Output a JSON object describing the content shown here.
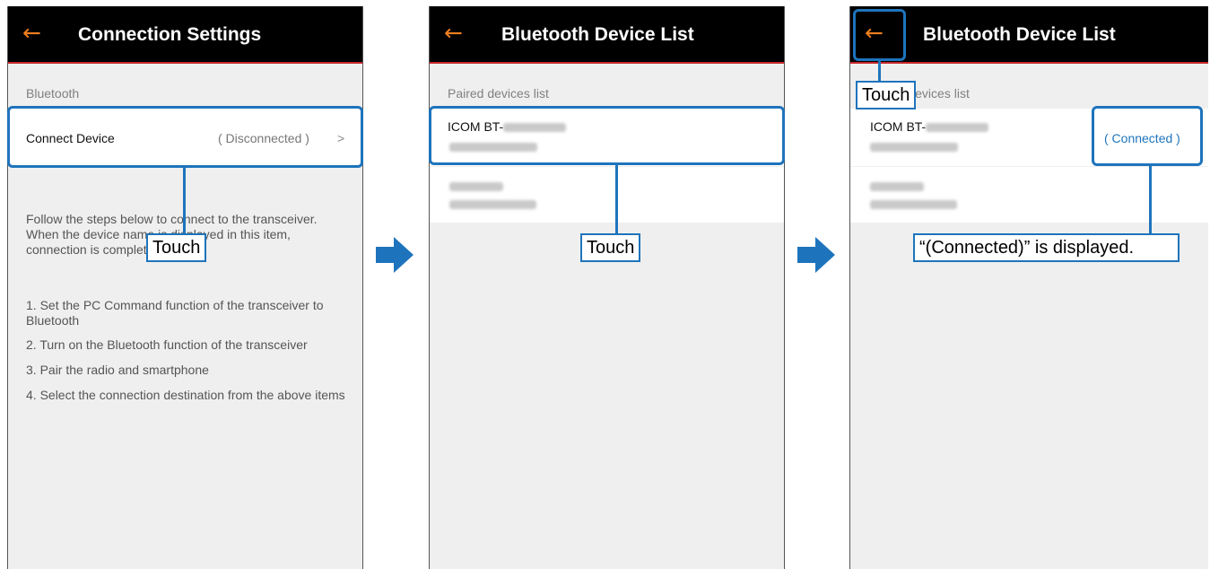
{
  "screen1": {
    "back_glyph": "←",
    "title": "Connection Settings",
    "section_label": "Bluetooth",
    "connect_device_label": "Connect Device",
    "connect_status": "( Disconnected )",
    "chevron": ">",
    "instructions": "Follow the steps below to connect to the transceiver. When the device name is displayed in this item, connection is complete.",
    "steps": [
      "1. Set the PC Command function of the transceiver to Bluetooth",
      "2. Turn on the Bluetooth function of the transceiver",
      "3. Pair the radio and smartphone",
      "4. Select the connection destination from the above items"
    ],
    "callout": "Touch"
  },
  "screen2": {
    "back_glyph": "←",
    "title": "Bluetooth Device List",
    "section_label": "Paired devices list",
    "devices": [
      {
        "name": "ICOM BT-"
      },
      {
        "name": ""
      }
    ],
    "callout": "Touch"
  },
  "screen3": {
    "back_glyph": "←",
    "title": "Bluetooth Device List",
    "section_label": "Paired devices list",
    "devices": [
      {
        "name": "ICOM BT-",
        "status": "( Connected )"
      },
      {
        "name": ""
      }
    ],
    "callout_touch": "Touch",
    "callout_connected": "“(Connected)” is displayed."
  },
  "colors": {
    "accent_orange": "#ee7e1f",
    "highlight_blue": "#1e74bc",
    "appbar_red_line": "#c8262c",
    "connected_blue": "#1e74bc"
  }
}
